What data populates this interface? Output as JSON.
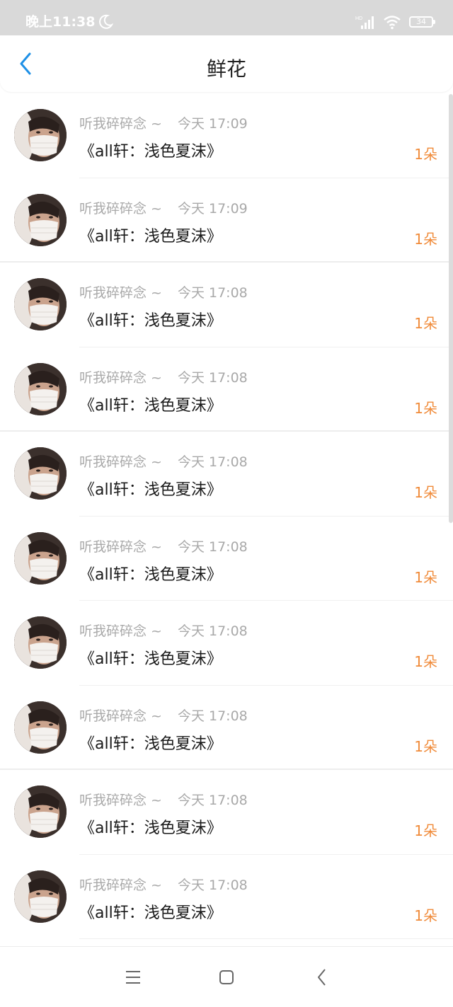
{
  "status_bar": {
    "time": "晚上11:38",
    "battery": "34",
    "network": "HD"
  },
  "header": {
    "title": "鲜花"
  },
  "items": [
    {
      "name": "听我碎碎念 ~",
      "time": "今天 17:09",
      "title": "《all轩：浅色夏沫》",
      "count": "1朵"
    },
    {
      "name": "听我碎碎念 ~",
      "time": "今天 17:09",
      "title": "《all轩：浅色夏沫》",
      "count": "1朵"
    },
    {
      "name": "听我碎碎念 ~",
      "time": "今天 17:08",
      "title": "《all轩：浅色夏沫》",
      "count": "1朵"
    },
    {
      "name": "听我碎碎念 ~",
      "time": "今天 17:08",
      "title": "《all轩：浅色夏沫》",
      "count": "1朵"
    },
    {
      "name": "听我碎碎念 ~",
      "time": "今天 17:08",
      "title": "《all轩：浅色夏沫》",
      "count": "1朵"
    },
    {
      "name": "听我碎碎念 ~",
      "time": "今天 17:08",
      "title": "《all轩：浅色夏沫》",
      "count": "1朵"
    },
    {
      "name": "听我碎碎念 ~",
      "time": "今天 17:08",
      "title": "《all轩：浅色夏沫》",
      "count": "1朵"
    },
    {
      "name": "听我碎碎念 ~",
      "time": "今天 17:08",
      "title": "《all轩：浅色夏沫》",
      "count": "1朵"
    },
    {
      "name": "听我碎碎念 ~",
      "time": "今天 17:08",
      "title": "《all轩：浅色夏沫》",
      "count": "1朵"
    },
    {
      "name": "听我碎碎念 ~",
      "time": "今天 17:08",
      "title": "《all轩：浅色夏沫》",
      "count": "1朵"
    }
  ],
  "nav": {
    "menu_icon": "menu-icon",
    "home_icon": "home-square-icon",
    "back_icon": "back-chevron-icon"
  },
  "colors": {
    "accent_blue": "#1e90e6",
    "count_orange": "#f08b3a",
    "meta_gray": "#a9a9a9",
    "status_bar_bg": "#d9d9d9"
  }
}
